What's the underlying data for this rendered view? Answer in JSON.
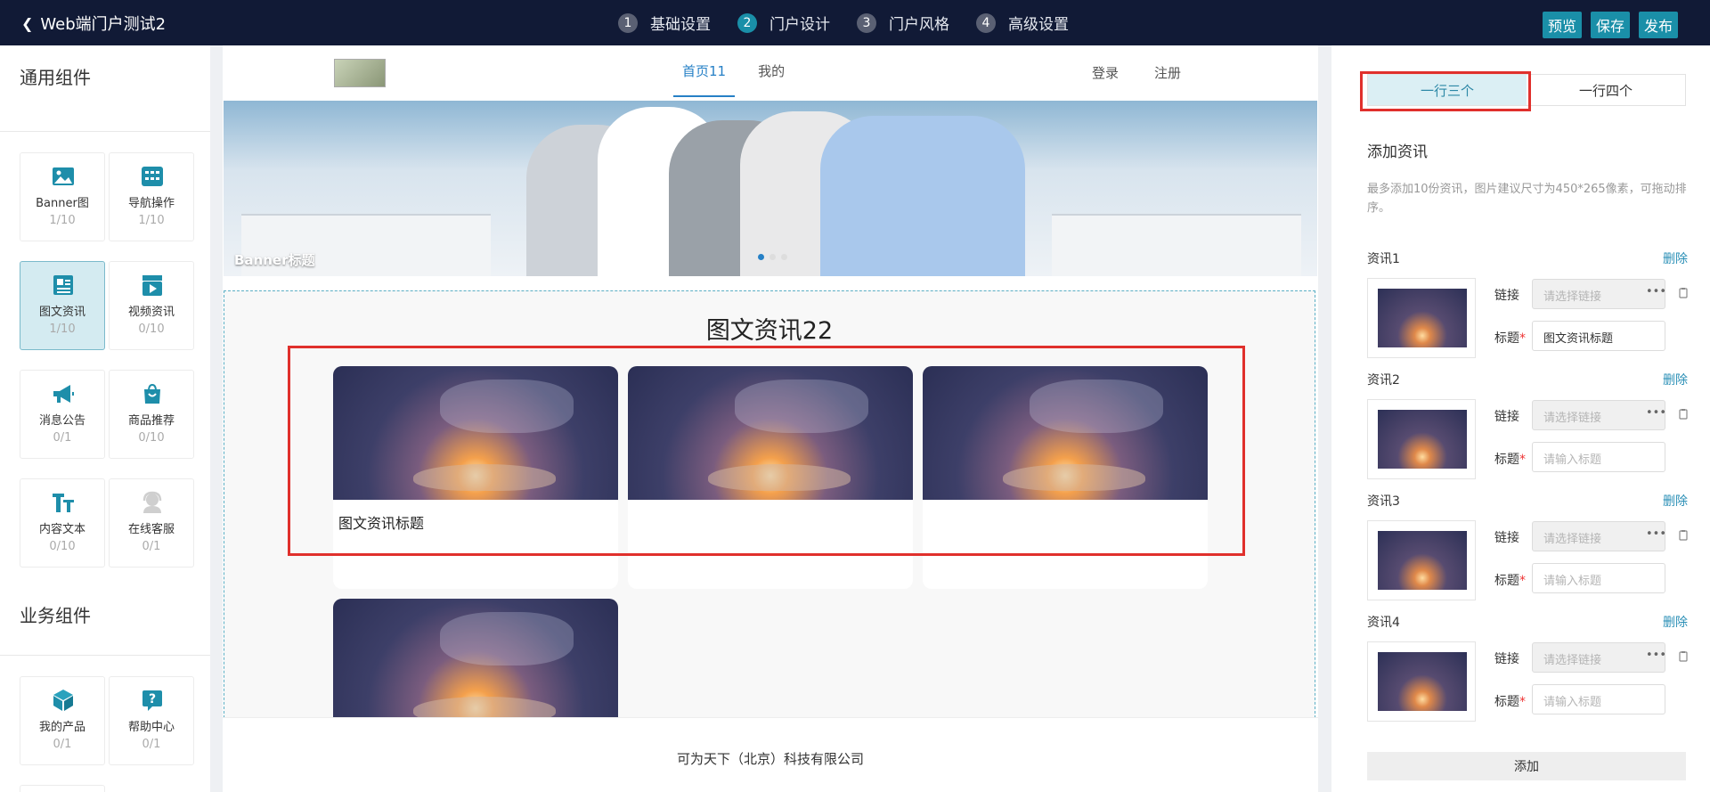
{
  "header": {
    "back_title": "Web端门户测试2",
    "steps": [
      {
        "num": "1",
        "label": "基础设置"
      },
      {
        "num": "2",
        "label": "门户设计"
      },
      {
        "num": "3",
        "label": "门户风格"
      },
      {
        "num": "4",
        "label": "高级设置"
      }
    ],
    "active_step": 2,
    "actions": {
      "preview": "预览",
      "save": "保存",
      "publish": "发布"
    }
  },
  "sidebar": {
    "general_title": "通用组件",
    "business_title": "业务组件",
    "general": [
      {
        "name": "Banner图",
        "count": "1/10",
        "icon": "image-icon"
      },
      {
        "name": "导航操作",
        "count": "1/10",
        "icon": "nav-icon"
      },
      {
        "name": "图文资讯",
        "count": "1/10",
        "icon": "news-icon"
      },
      {
        "name": "视频资讯",
        "count": "0/10",
        "icon": "video-icon"
      },
      {
        "name": "消息公告",
        "count": "0/1",
        "icon": "megaphone-icon"
      },
      {
        "name": "商品推荐",
        "count": "0/10",
        "icon": "shopping-bag-icon"
      },
      {
        "name": "内容文本",
        "count": "0/10",
        "icon": "text-icon"
      },
      {
        "name": "在线客服",
        "count": "0/1",
        "icon": "customer-service-icon"
      }
    ],
    "business": [
      {
        "name": "我的产品",
        "count": "0/1",
        "icon": "cube-icon"
      },
      {
        "name": "帮助中心",
        "count": "0/1",
        "icon": "help-icon"
      }
    ]
  },
  "preview": {
    "nav_tabs": [
      "首页11",
      "我的"
    ],
    "login": "登录",
    "register": "注册",
    "banner_title": "Banner标题",
    "news_heading": "图文资讯22",
    "cards": [
      {
        "caption": "图文资讯标题"
      },
      {
        "caption": ""
      },
      {
        "caption": ""
      },
      {
        "caption": ""
      }
    ],
    "footer": "可为天下（北京）科技有限公司"
  },
  "panel": {
    "layout_tabs": [
      "一行三个",
      "一行四个"
    ],
    "title": "添加资讯",
    "hint": "最多添加10份资讯，图片建议尺寸为450*265像素，可拖动排序。",
    "delete_label": "删除",
    "link_label": "链接",
    "title_label": "标题",
    "link_placeholder": "请选择链接",
    "title_placeholder": "请输入标题",
    "items": [
      {
        "label": "资讯1",
        "title_value": "图文资讯标题"
      },
      {
        "label": "资讯2",
        "title_value": ""
      },
      {
        "label": "资讯3",
        "title_value": ""
      },
      {
        "label": "资讯4",
        "title_value": ""
      }
    ],
    "add_label": "添加"
  },
  "colors": {
    "topbar": "#111a36",
    "accent": "#1a8fa8",
    "link_blue": "#2680c6",
    "highlight_red": "#e0302c"
  }
}
